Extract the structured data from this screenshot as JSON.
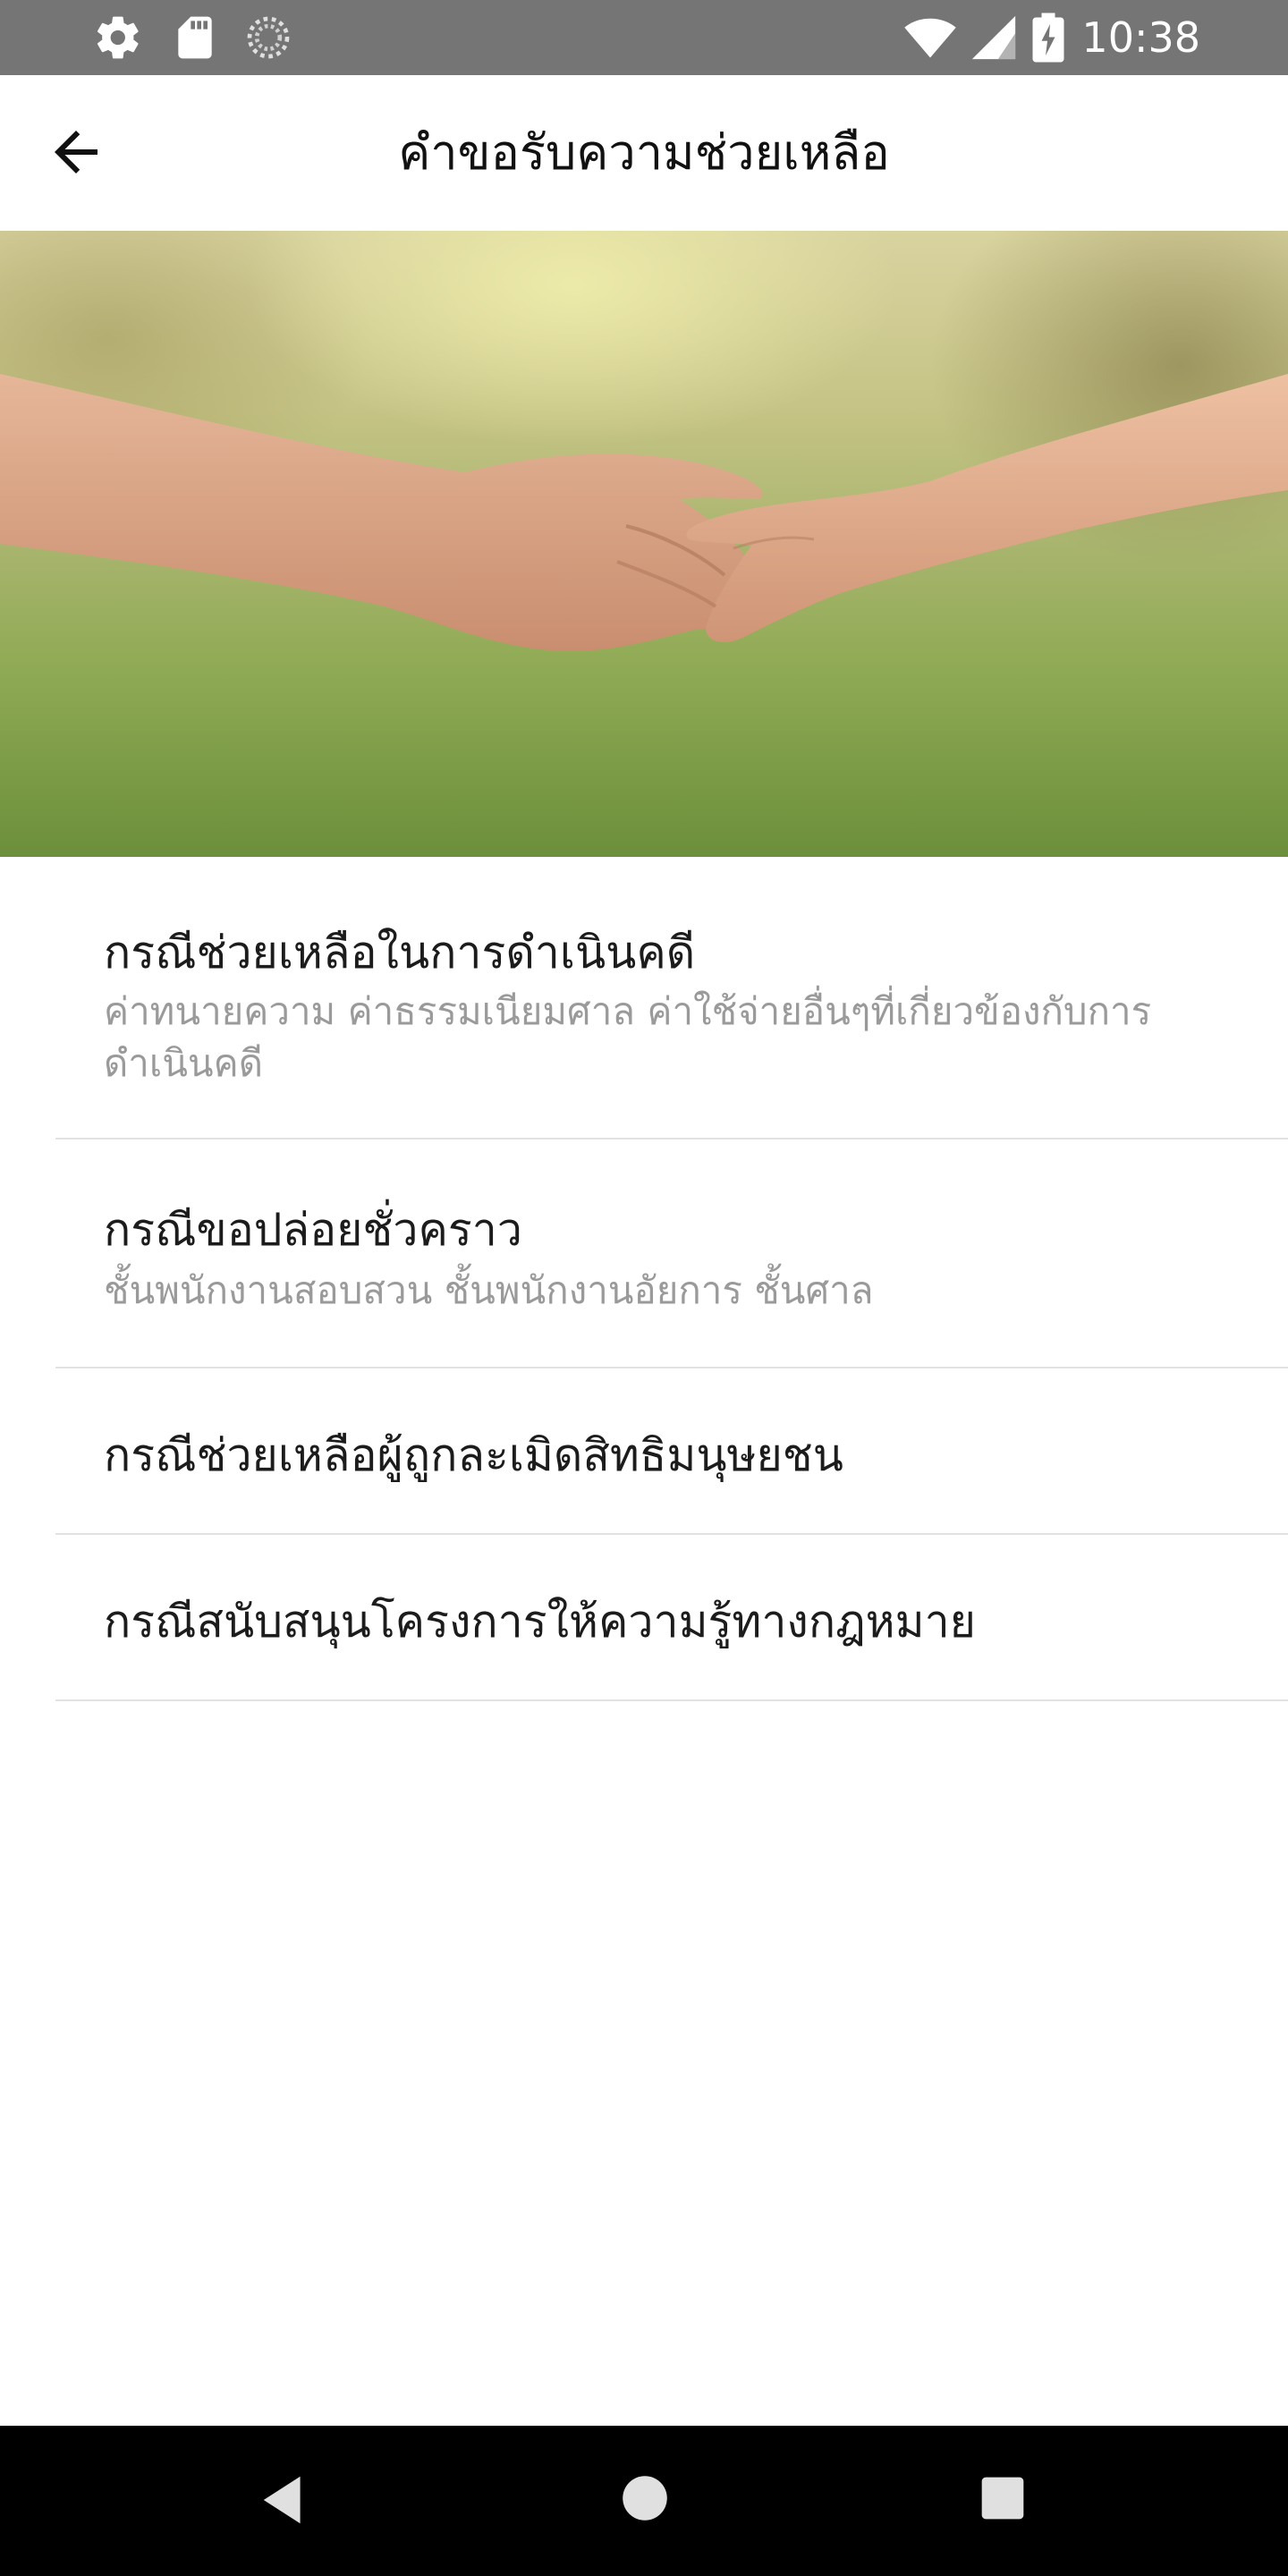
{
  "status_bar": {
    "time": "10:38",
    "left_icons": [
      "gear-icon",
      "sd-card-icon",
      "sync-icon"
    ],
    "right_icons": [
      "wifi-icon",
      "signal-icon",
      "battery-charging-icon"
    ],
    "background": "#757575"
  },
  "app_bar": {
    "title": "คำขอรับความช่วยเหลือ",
    "back_icon": "arrow-left-icon"
  },
  "hero": {
    "description": "hands-holding-photo"
  },
  "menu": {
    "items": [
      {
        "title": "กรณีช่วยเหลือในการดำเนินคดี",
        "subtitle": "ค่าทนายความ ค่าธรรมเนียมศาล ค่าใช้จ่ายอื่นๆที่เกี่ยวข้องกับการดำเนินคดี"
      },
      {
        "title": "กรณีขอปล่อยชั่วคราว",
        "subtitle": "ชั้นพนักงานสอบสวน ชั้นพนักงานอัยการ ชั้นศาล"
      },
      {
        "title": "กรณีช่วยเหลือผู้ถูกละเมิดสิทธิมนุษยชน"
      },
      {
        "title": "กรณีสนับสนุนโครงการให้ความรู้ทางกฎหมาย"
      }
    ]
  },
  "nav_bar": {
    "buttons": [
      "back-triangle-icon",
      "home-circle-icon",
      "recents-square-icon"
    ]
  }
}
